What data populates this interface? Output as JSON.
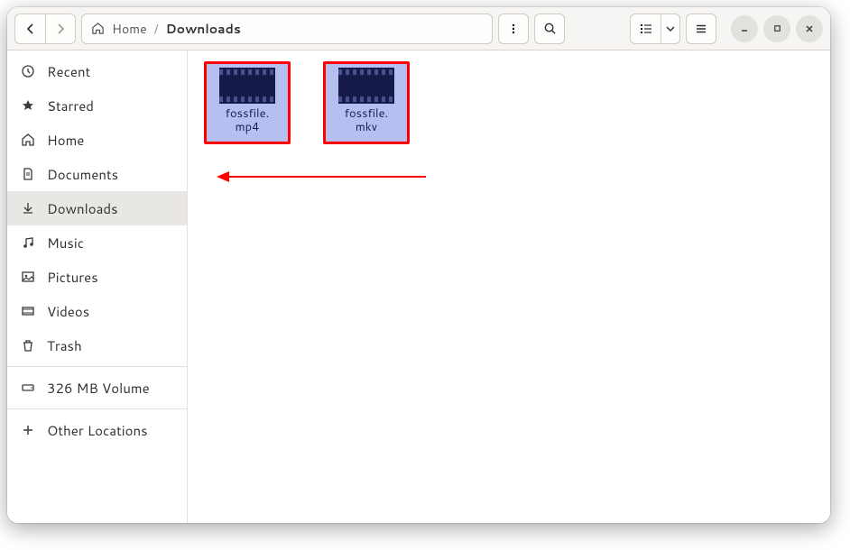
{
  "pathbar": {
    "home_label": "Home",
    "current_label": "Downloads"
  },
  "sidebar": {
    "items": [
      {
        "icon": "recent-icon",
        "label": "Recent"
      },
      {
        "icon": "starred-icon",
        "label": "Starred"
      },
      {
        "icon": "home-icon",
        "label": "Home"
      },
      {
        "icon": "documents-icon",
        "label": "Documents"
      },
      {
        "icon": "downloads-icon",
        "label": "Downloads",
        "active": true
      },
      {
        "icon": "music-icon",
        "label": "Music"
      },
      {
        "icon": "pictures-icon",
        "label": "Pictures"
      },
      {
        "icon": "videos-icon",
        "label": "Videos"
      },
      {
        "icon": "trash-icon",
        "label": "Trash"
      }
    ],
    "volume": {
      "label": "326 MB Volume"
    },
    "other": {
      "label": "Other Locations"
    }
  },
  "files": [
    {
      "name_line1": "fossfile.",
      "name_line2": "mp4"
    },
    {
      "name_line1": "fossfile.",
      "name_line2": "mkv"
    }
  ]
}
